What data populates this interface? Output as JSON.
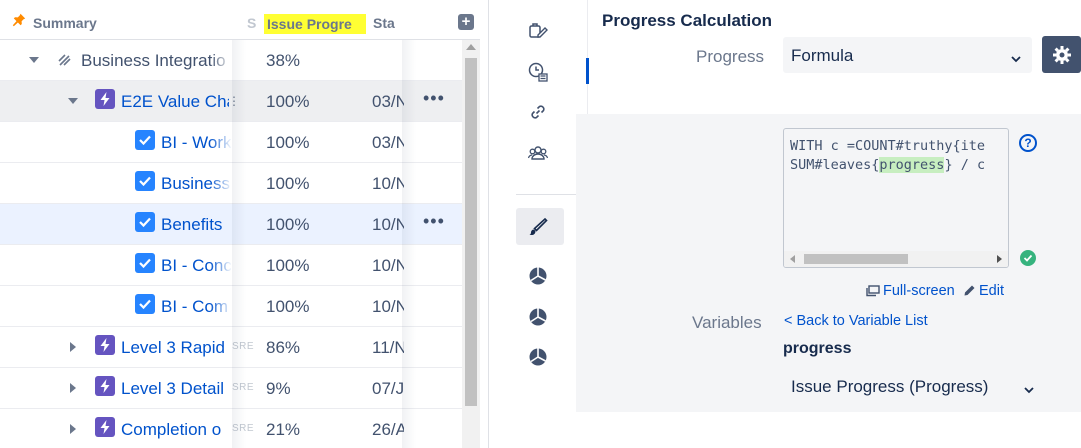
{
  "grid": {
    "headers": {
      "summary": "Summary",
      "s_stub": "S",
      "issue_progress": "Issue Progre",
      "status": "Sta",
      "add": "+"
    },
    "rows": [
      {
        "summary": "Business Integratio",
        "progress": "38%",
        "date": "",
        "tag": ""
      },
      {
        "summary": "E2E Value Cha",
        "progress": "100%",
        "date": "03/N",
        "tag": ""
      },
      {
        "summary": "BI - Work",
        "progress": "100%",
        "date": "03/N",
        "tag": ""
      },
      {
        "summary": "Business",
        "progress": "100%",
        "date": "10/N",
        "tag": ""
      },
      {
        "summary": "Benefits",
        "progress": "100%",
        "date": "10/N",
        "tag": ""
      },
      {
        "summary": "BI - Conc",
        "progress": "100%",
        "date": "10/N",
        "tag": ""
      },
      {
        "summary": "BI - Com",
        "progress": "100%",
        "date": "10/N",
        "tag": ""
      },
      {
        "summary": "Level 3 Rapid",
        "progress": "86%",
        "date": "11/N",
        "tag": "SRE"
      },
      {
        "summary": "Level 3 Detail",
        "progress": "9%",
        "date": "07/J",
        "tag": "SRE"
      },
      {
        "summary": "Completion o",
        "progress": "21%",
        "date": "26/A",
        "tag": "SRE"
      }
    ],
    "more_actions": "•••",
    "drag_handle": "⋮"
  },
  "panel": {
    "title": "Progress Calculation",
    "progress_label": "Progress",
    "progress_value": "Formula",
    "formula_line1_pre": "WITH c =COUNT#truthy{ite",
    "formula_line2_pre": "SUM#leaves{",
    "formula_line2_word": "progress",
    "formula_line2_post": "} / c",
    "help": "?",
    "fullscreen_label": "Full-screen",
    "edit_label": "Edit",
    "variables_label": "Variables",
    "back_label": "< Back to Variable List",
    "variable_name": "progress",
    "variable_value": "Issue Progress (Progress)"
  },
  "icons": {
    "pin": "pin-icon",
    "gear": "gear-icon",
    "brush": "brush-icon",
    "check": "check-icon"
  },
  "colors": {
    "accent": "#0052cc",
    "epic": "#6554c0",
    "checkbox": "#2684ff",
    "highlight": "#ffff33",
    "success": "#36b37e",
    "formula_highlight": "#c7eec0"
  }
}
